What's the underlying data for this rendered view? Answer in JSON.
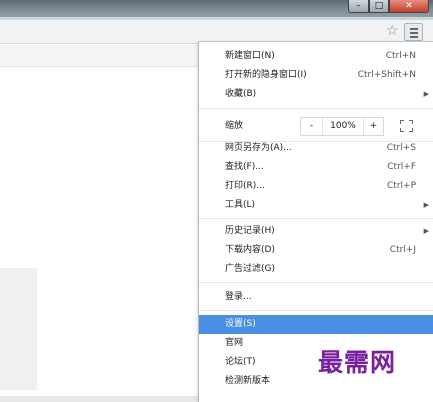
{
  "window": {
    "minimize_glyph": "–",
    "maximize_glyph": "□",
    "close_glyph": "✕"
  },
  "toolbar": {
    "bookmark_icon": "star-icon",
    "bookmark_glyph": "☆",
    "menu_icon": "hamburger-menu-icon"
  },
  "menu": {
    "group1": [
      {
        "label": "新建窗口(N)",
        "shortcut": "Ctrl+N"
      },
      {
        "label": "打开新的隐身窗口(I)",
        "shortcut": "Ctrl+Shift+N"
      },
      {
        "label": "收藏(B)",
        "shortcut": "",
        "submenu": true
      }
    ],
    "zoom": {
      "label": "缩放",
      "minus": "-",
      "value": "100%",
      "plus": "+"
    },
    "group2": [
      {
        "label": "网页另存为(A)...",
        "shortcut": "Ctrl+S"
      },
      {
        "label": "查找(F)...",
        "shortcut": "Ctrl+F"
      },
      {
        "label": "打印(R)...",
        "shortcut": "Ctrl+P"
      },
      {
        "label": "工具(L)",
        "shortcut": "",
        "submenu": true
      }
    ],
    "group3": [
      {
        "label": "历史记录(H)",
        "shortcut": "",
        "submenu": true
      },
      {
        "label": "下载内容(D)",
        "shortcut": "Ctrl+J"
      },
      {
        "label": "广告过滤(G)",
        "shortcut": ""
      }
    ],
    "group4": [
      {
        "label": "登录...",
        "shortcut": ""
      }
    ],
    "group5": [
      {
        "label": "设置(S)",
        "shortcut": "",
        "selected": true
      },
      {
        "label": "官网",
        "shortcut": ""
      },
      {
        "label": "论坛(T)",
        "shortcut": ""
      },
      {
        "label": "检测新版本",
        "shortcut": ""
      }
    ],
    "submenu_glyph": "▶"
  },
  "watermark": {
    "text": "最需网"
  },
  "colors": {
    "selected_bg": "#4a90e2",
    "watermark": "#7b1fa2",
    "close_button": "#c23f2a"
  }
}
